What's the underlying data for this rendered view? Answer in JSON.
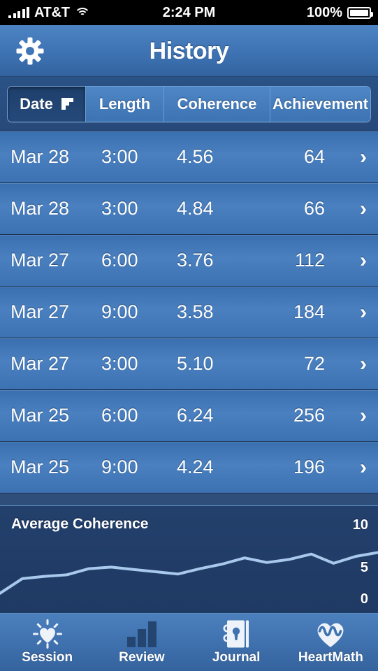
{
  "status_bar": {
    "carrier": "AT&T",
    "time": "2:24 PM",
    "battery_percent": "100%",
    "signal_icon": "signal-bars-icon",
    "wifi_icon": "wifi-icon",
    "battery_icon": "battery-full-icon"
  },
  "nav": {
    "title": "History",
    "settings_icon": "gear-icon"
  },
  "columns": {
    "date": "Date",
    "length": "Length",
    "coherence": "Coherence",
    "achievement": "Achievement",
    "sort_icon": "sort-descending-icon",
    "active": "Date"
  },
  "rows": [
    {
      "date": "Mar 28",
      "length": "3:00",
      "coherence": "4.56",
      "achievement": "64",
      "chevron": "›"
    },
    {
      "date": "Mar 28",
      "length": "3:00",
      "coherence": "4.84",
      "achievement": "66",
      "chevron": "›"
    },
    {
      "date": "Mar 27",
      "length": "6:00",
      "coherence": "3.76",
      "achievement": "112",
      "chevron": "›"
    },
    {
      "date": "Mar 27",
      "length": "9:00",
      "coherence": "3.58",
      "achievement": "184",
      "chevron": "›"
    },
    {
      "date": "Mar 27",
      "length": "3:00",
      "coherence": "5.10",
      "achievement": "72",
      "chevron": "›"
    },
    {
      "date": "Mar 25",
      "length": "6:00",
      "coherence": "6.24",
      "achievement": "256",
      "chevron": "›"
    },
    {
      "date": "Mar 25",
      "length": "9:00",
      "coherence": "4.24",
      "achievement": "196",
      "chevron": "›"
    }
  ],
  "chart_data": {
    "type": "line",
    "title": "Average Coherence",
    "xlabel": "",
    "ylabel": "",
    "ylim": [
      0,
      10
    ],
    "yticks": [
      0,
      5,
      10
    ],
    "ytick_labels": [
      "0",
      "5",
      "10"
    ],
    "grid": false,
    "legend": "none",
    "line_color": "#a8c8ec",
    "background": "#213d68",
    "x": [
      0,
      1,
      2,
      3,
      4,
      5,
      6,
      7,
      8,
      9,
      10,
      11,
      12,
      13,
      14,
      15,
      16
    ],
    "values": [
      1.2,
      3.1,
      3.4,
      3.6,
      4.4,
      4.6,
      4.3,
      4.0,
      3.7,
      4.4,
      5.0,
      5.8,
      5.2,
      5.6,
      6.3,
      5.1,
      6.0,
      6.5
    ]
  },
  "tabs": [
    {
      "label": "Session",
      "icon": "radiant-heart-icon",
      "active": false
    },
    {
      "label": "Review",
      "icon": "bar-chart-icon",
      "active": true
    },
    {
      "label": "Journal",
      "icon": "locked-journal-icon",
      "active": false
    },
    {
      "label": "HeartMath",
      "icon": "heart-wave-icon",
      "active": false
    }
  ]
}
